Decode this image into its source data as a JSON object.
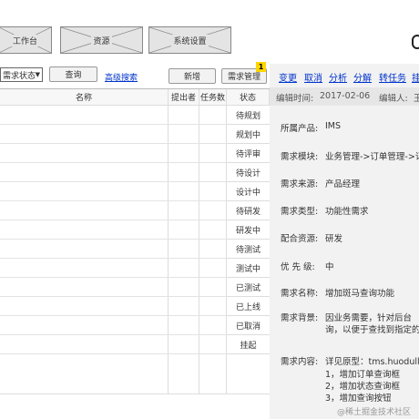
{
  "nav": {
    "tabs": [
      {
        "label": "工作台"
      },
      {
        "label": "资源"
      },
      {
        "label": "系统设置"
      }
    ]
  },
  "toolbar": {
    "filter_select": "需求状态",
    "query_button": "查询",
    "advanced_search": "高级搜索",
    "add_button": "新增",
    "manage_button": "需求管理",
    "manage_badge": "1"
  },
  "table": {
    "headers": {
      "name": "名称",
      "proposer": "提出者",
      "tasks": "任务数",
      "status": "状态"
    },
    "statuses": [
      "待规划",
      "规划中",
      "待评审",
      "待设计",
      "设计中",
      "待研发",
      "研发中",
      "待测试",
      "测试中",
      "已测试",
      "已上线",
      "已取消",
      "挂起"
    ]
  },
  "detail": {
    "actions": [
      "变更",
      "取消",
      "分析",
      "分解",
      "转任务",
      "挂"
    ],
    "edit_time_label": "编辑时间:",
    "edit_time": "2017-02-06",
    "editor_label": "编辑人:",
    "editor": "王",
    "product_label": "所属产品:",
    "product": "IMS",
    "module_label": "需求模块:",
    "module": "业务管理->订单管理->订",
    "source_label": "需求来源:",
    "source": "产品经理",
    "type_label": "需求类型:",
    "type": "功能性需求",
    "resource_label": "配合资源:",
    "resource": "研发",
    "priority_label": "优 先 级:",
    "priority": "中",
    "name_label": "需求名称:",
    "name": "增加斑马查询功能",
    "background_label": "需求背景:",
    "background_line1": "因业务需要，针对后台",
    "background_line2": "询，以便于查找到指定的",
    "content_label": "需求内容:",
    "content_line1": "详见原型：tms.huodull.c",
    "content_items": [
      "1，增加订单查询框",
      "2，增加状态查询框",
      "3，增加查询按钮"
    ]
  },
  "watermark": "@稀土掘金技术社区"
}
